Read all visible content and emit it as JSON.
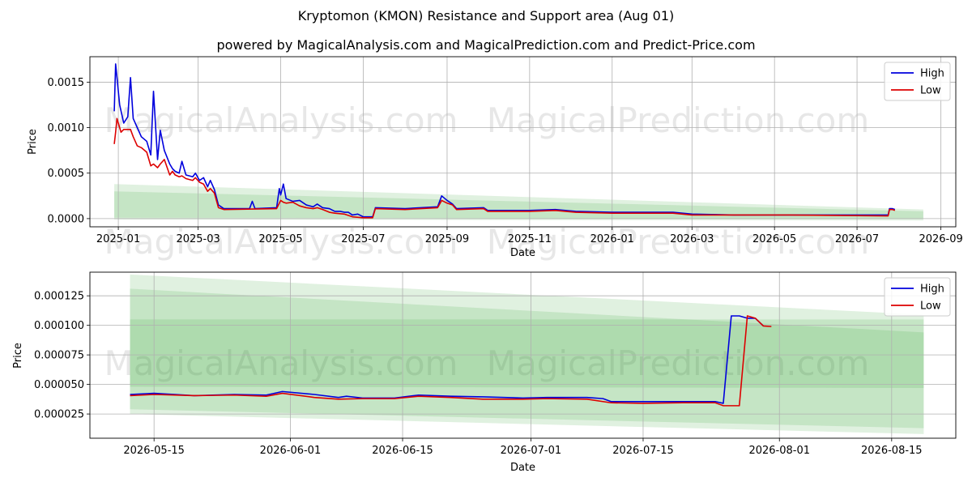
{
  "title": "Kryptomon (KMON) Resistance and Support area (Aug 01)",
  "subtitle": "powered by MagicalAnalysis.com and MagicalPrediction.com and Predict-Price.com",
  "watermarks": [
    "MagicalAnalysis.com",
    "MagicalPrediction.com"
  ],
  "colors": {
    "high": "#0000dd",
    "low": "#dd0000",
    "band": "#2ca02c",
    "grid": "#b0b0b0"
  },
  "chart_data": [
    {
      "type": "line",
      "xlabel": "Date",
      "ylabel": "Price",
      "xlim": [
        "2024-12-11",
        "2026-09-12"
      ],
      "ylim": [
        -9e-05,
        0.00178
      ],
      "xticks": [
        "2025-01",
        "2025-03",
        "2025-05",
        "2025-07",
        "2025-09",
        "2025-11",
        "2026-01",
        "2026-03",
        "2026-05",
        "2026-07",
        "2026-09"
      ],
      "yticks": [
        "0.0000",
        "0.0005",
        "0.0010",
        "0.0015"
      ],
      "grid": true,
      "legend": "top-right",
      "series": [
        {
          "name": "High",
          "points": [
            [
              "2024-12-29",
              0.00118
            ],
            [
              "2024-12-30",
              0.0017
            ],
            [
              "2025-01-02",
              0.00125
            ],
            [
              "2025-01-05",
              0.00105
            ],
            [
              "2025-01-08",
              0.00112
            ],
            [
              "2025-01-10",
              0.00155
            ],
            [
              "2025-01-12",
              0.0011
            ],
            [
              "2025-01-15",
              0.001
            ],
            [
              "2025-01-18",
              0.0009
            ],
            [
              "2025-01-22",
              0.00085
            ],
            [
              "2025-01-25",
              0.0007
            ],
            [
              "2025-01-27",
              0.0014
            ],
            [
              "2025-01-30",
              0.00065
            ],
            [
              "2025-02-01",
              0.00097
            ],
            [
              "2025-02-04",
              0.00075
            ],
            [
              "2025-02-08",
              0.0006
            ],
            [
              "2025-02-10",
              0.00055
            ],
            [
              "2025-02-12",
              0.00052
            ],
            [
              "2025-02-15",
              0.0005
            ],
            [
              "2025-02-17",
              0.00063
            ],
            [
              "2025-02-20",
              0.00048
            ],
            [
              "2025-02-25",
              0.00046
            ],
            [
              "2025-02-27",
              0.0005
            ],
            [
              "2025-03-02",
              0.00042
            ],
            [
              "2025-03-05",
              0.00045
            ],
            [
              "2025-03-08",
              0.00035
            ],
            [
              "2025-03-10",
              0.00042
            ],
            [
              "2025-03-13",
              0.00032
            ],
            [
              "2025-03-16",
              0.00015
            ],
            [
              "2025-03-20",
              0.00011
            ],
            [
              "2025-04-08",
              0.00011
            ],
            [
              "2025-04-10",
              0.00019
            ],
            [
              "2025-04-12",
              0.00011
            ],
            [
              "2025-04-28",
              0.00012
            ],
            [
              "2025-04-30",
              0.00033
            ],
            [
              "2025-05-01",
              0.00026
            ],
            [
              "2025-05-03",
              0.00038
            ],
            [
              "2025-05-05",
              0.00022
            ],
            [
              "2025-05-10",
              0.00019
            ],
            [
              "2025-05-15",
              0.0002
            ],
            [
              "2025-05-20",
              0.00015
            ],
            [
              "2025-05-25",
              0.00013
            ],
            [
              "2025-05-28",
              0.00016
            ],
            [
              "2025-06-01",
              0.00012
            ],
            [
              "2025-06-06",
              0.00011
            ],
            [
              "2025-06-10",
              8e-05
            ],
            [
              "2025-06-14",
              8e-05
            ],
            [
              "2025-06-17",
              7e-05
            ],
            [
              "2025-06-20",
              7e-05
            ],
            [
              "2025-06-23",
              4e-05
            ],
            [
              "2025-06-27",
              5e-05
            ],
            [
              "2025-07-01",
              2e-05
            ],
            [
              "2025-07-08",
              2e-05
            ],
            [
              "2025-07-10",
              0.00012
            ],
            [
              "2025-08-01",
              0.00011
            ],
            [
              "2025-08-25",
              0.00013
            ],
            [
              "2025-08-28",
              0.00025
            ],
            [
              "2025-09-01",
              0.0002
            ],
            [
              "2025-09-05",
              0.00016
            ],
            [
              "2025-09-08",
              0.00011
            ],
            [
              "2025-09-28",
              0.00012
            ],
            [
              "2025-10-01",
              9e-05
            ],
            [
              "2025-11-01",
              9e-05
            ],
            [
              "2025-11-20",
              0.0001
            ],
            [
              "2025-12-05",
              8e-05
            ],
            [
              "2026-01-01",
              7e-05
            ],
            [
              "2026-02-15",
              7e-05
            ],
            [
              "2026-03-01",
              5e-05
            ],
            [
              "2026-04-01",
              4e-05
            ],
            [
              "2026-05-12",
              4e-05
            ],
            [
              "2026-07-24",
              4e-05
            ],
            [
              "2026-07-25",
              0.00011
            ],
            [
              "2026-07-27",
              0.00011
            ],
            [
              "2026-07-29",
              0.0001
            ]
          ]
        },
        {
          "name": "Low",
          "points": [
            [
              "2024-12-29",
              0.00082
            ],
            [
              "2024-12-30",
              0.00095
            ],
            [
              "2024-12-31",
              0.0011
            ],
            [
              "2025-01-03",
              0.00095
            ],
            [
              "2025-01-05",
              0.00098
            ],
            [
              "2025-01-10",
              0.00098
            ],
            [
              "2025-01-12",
              0.0009
            ],
            [
              "2025-01-15",
              0.0008
            ],
            [
              "2025-01-18",
              0.00078
            ],
            [
              "2025-01-22",
              0.00073
            ],
            [
              "2025-01-25",
              0.00058
            ],
            [
              "2025-01-27",
              0.0006
            ],
            [
              "2025-01-30",
              0.00056
            ],
            [
              "2025-02-01",
              0.0006
            ],
            [
              "2025-02-04",
              0.00065
            ],
            [
              "2025-02-08",
              0.00048
            ],
            [
              "2025-02-10",
              0.00052
            ],
            [
              "2025-02-12",
              0.00048
            ],
            [
              "2025-02-15",
              0.00046
            ],
            [
              "2025-02-17",
              0.00047
            ],
            [
              "2025-02-20",
              0.00044
            ],
            [
              "2025-02-25",
              0.00042
            ],
            [
              "2025-02-27",
              0.00045
            ],
            [
              "2025-03-02",
              0.0004
            ],
            [
              "2025-03-05",
              0.00038
            ],
            [
              "2025-03-08",
              0.0003
            ],
            [
              "2025-03-10",
              0.00033
            ],
            [
              "2025-03-13",
              0.00028
            ],
            [
              "2025-03-16",
              0.00012
            ],
            [
              "2025-03-20",
              0.0001
            ],
            [
              "2025-04-28",
              0.00011
            ],
            [
              "2025-05-01",
              0.0002
            ],
            [
              "2025-05-03",
              0.00018
            ],
            [
              "2025-05-05",
              0.00017
            ],
            [
              "2025-05-10",
              0.00018
            ],
            [
              "2025-05-15",
              0.00014
            ],
            [
              "2025-05-20",
              0.00012
            ],
            [
              "2025-05-25",
              0.00011
            ],
            [
              "2025-05-28",
              0.00012
            ],
            [
              "2025-06-01",
              0.0001
            ],
            [
              "2025-06-06",
              7e-05
            ],
            [
              "2025-06-10",
              6e-05
            ],
            [
              "2025-06-17",
              5e-05
            ],
            [
              "2025-06-23",
              2e-05
            ],
            [
              "2025-07-01",
              1e-05
            ],
            [
              "2025-07-08",
              1e-05
            ],
            [
              "2025-07-10",
              0.00011
            ],
            [
              "2025-08-01",
              0.0001
            ],
            [
              "2025-08-25",
              0.00012
            ],
            [
              "2025-08-28",
              0.0002
            ],
            [
              "2025-09-01",
              0.00017
            ],
            [
              "2025-09-05",
              0.00015
            ],
            [
              "2025-09-08",
              0.0001
            ],
            [
              "2025-09-28",
              0.00011
            ],
            [
              "2025-10-01",
              8e-05
            ],
            [
              "2025-11-01",
              8e-05
            ],
            [
              "2025-11-20",
              9e-05
            ],
            [
              "2025-12-05",
              7e-05
            ],
            [
              "2026-01-01",
              6e-05
            ],
            [
              "2026-02-15",
              6e-05
            ],
            [
              "2026-03-01",
              4e-05
            ],
            [
              "2026-04-01",
              4e-05
            ],
            [
              "2026-05-12",
              4e-05
            ],
            [
              "2026-07-24",
              3e-05
            ],
            [
              "2026-07-25",
              0.0001
            ],
            [
              "2026-07-27",
              0.0001
            ],
            [
              "2026-07-29",
              9e-05
            ]
          ]
        }
      ],
      "bands": [
        {
          "x": [
            "2024-12-29",
            "2026-08-19"
          ],
          "lower": [
            1e-05,
            0.0
          ],
          "upper": [
            0.00038,
            0.0001
          ]
        },
        {
          "x": [
            "2024-12-29",
            "2026-08-19"
          ],
          "lower": [
            -1e-05,
            -2e-05
          ],
          "upper": [
            0.0003,
            8e-05
          ]
        }
      ]
    },
    {
      "type": "line",
      "xlabel": "Date",
      "ylabel": "Price",
      "xlim": [
        "2026-05-07",
        "2026-08-23"
      ],
      "ylim": [
        4.5e-06,
        0.000145
      ],
      "xticks": [
        "2026-05-15",
        "2026-06-01",
        "2026-06-15",
        "2026-07-01",
        "2026-07-15",
        "2026-08-01",
        "2026-08-15"
      ],
      "yticks": [
        "0.000025",
        "0.000050",
        "0.000075",
        "0.000100",
        "0.000125"
      ],
      "grid": true,
      "legend": "top-right",
      "series": [
        {
          "name": "High",
          "points": [
            [
              "2026-05-12",
              4.15e-05
            ],
            [
              "2026-05-15",
              4.25e-05
            ],
            [
              "2026-05-20",
              4.05e-05
            ],
            [
              "2026-05-25",
              4.15e-05
            ],
            [
              "2026-05-29",
              4.1e-05
            ],
            [
              "2026-05-31",
              4.4e-05
            ],
            [
              "2026-06-04",
              4.15e-05
            ],
            [
              "2026-06-07",
              3.9e-05
            ],
            [
              "2026-06-08",
              4e-05
            ],
            [
              "2026-06-10",
              3.85e-05
            ],
            [
              "2026-06-14",
              3.85e-05
            ],
            [
              "2026-06-17",
              4.1e-05
            ],
            [
              "2026-06-21",
              4e-05
            ],
            [
              "2026-06-25",
              3.95e-05
            ],
            [
              "2026-06-30",
              3.85e-05
            ],
            [
              "2026-07-03",
              3.9e-05
            ],
            [
              "2026-07-08",
              3.9e-05
            ],
            [
              "2026-07-10",
              3.8e-05
            ],
            [
              "2026-07-11",
              3.55e-05
            ],
            [
              "2026-07-20",
              3.55e-05
            ],
            [
              "2026-07-24",
              3.55e-05
            ],
            [
              "2026-07-25",
              3.4e-05
            ],
            [
              "2026-07-26",
              0.000108
            ],
            [
              "2026-07-27",
              0.000108
            ],
            [
              "2026-07-28",
              0.000106
            ],
            [
              "2026-07-29",
              0.000106
            ],
            [
              "2026-07-30",
              9.95e-05
            ]
          ]
        },
        {
          "name": "Low",
          "points": [
            [
              "2026-05-12",
              4.05e-05
            ],
            [
              "2026-05-15",
              4.15e-05
            ],
            [
              "2026-05-20",
              4.05e-05
            ],
            [
              "2026-05-25",
              4.1e-05
            ],
            [
              "2026-05-29",
              4e-05
            ],
            [
              "2026-05-31",
              4.25e-05
            ],
            [
              "2026-06-04",
              3.9e-05
            ],
            [
              "2026-06-07",
              3.75e-05
            ],
            [
              "2026-06-10",
              3.8e-05
            ],
            [
              "2026-06-14",
              3.8e-05
            ],
            [
              "2026-06-17",
              4e-05
            ],
            [
              "2026-06-21",
              3.9e-05
            ],
            [
              "2026-06-25",
              3.75e-05
            ],
            [
              "2026-06-30",
              3.75e-05
            ],
            [
              "2026-07-03",
              3.8e-05
            ],
            [
              "2026-07-08",
              3.75e-05
            ],
            [
              "2026-07-11",
              3.45e-05
            ],
            [
              "2026-07-15",
              3.4e-05
            ],
            [
              "2026-07-20",
              3.45e-05
            ],
            [
              "2026-07-24",
              3.45e-05
            ],
            [
              "2026-07-25",
              3.2e-05
            ],
            [
              "2026-07-27",
              3.2e-05
            ],
            [
              "2026-07-28",
              0.000108
            ],
            [
              "2026-07-29",
              0.000106
            ],
            [
              "2026-07-30",
              9.95e-05
            ],
            [
              "2026-07-31",
              9.9e-05
            ]
          ]
        }
      ],
      "bands": [
        {
          "x": [
            "2026-05-12",
            "2026-08-19"
          ],
          "lower": [
            2.5e-05,
            8e-06
          ],
          "upper": [
            0.000143,
            0.000109
          ]
        },
        {
          "x": [
            "2026-05-12",
            "2026-08-19"
          ],
          "lower": [
            2.9e-05,
            1.3e-05
          ],
          "upper": [
            0.000131,
            9.4e-05
          ]
        },
        {
          "x": [
            "2026-05-12",
            "2026-08-19"
          ],
          "lower": [
            4.8e-05,
            4.7e-05
          ],
          "upper": [
            0.000105,
            0.000105
          ]
        }
      ]
    }
  ]
}
